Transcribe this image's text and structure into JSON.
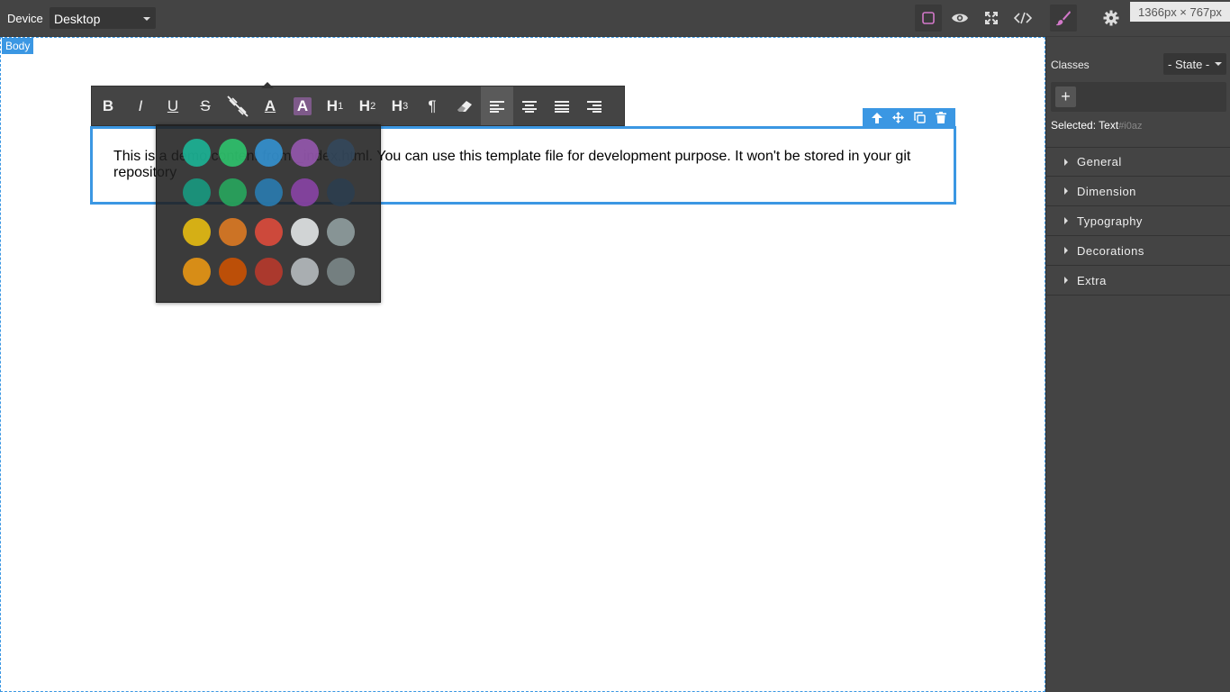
{
  "topbar": {
    "device_label": "Device",
    "device_value": "Desktop",
    "size_badge": "1366px × 767px",
    "buttons": [
      {
        "name": "sw-visibility-icon",
        "active": true
      },
      {
        "name": "preview-eye-icon",
        "active": false
      },
      {
        "name": "fullscreen-icon",
        "active": false
      },
      {
        "name": "code-icon",
        "active": false
      },
      {
        "name": "style-manager-brush-icon",
        "active": true
      },
      {
        "name": "settings-gear-icon",
        "active": false
      }
    ]
  },
  "canvas": {
    "body_badge": "Body",
    "text_content": "This is a demo content from _index.html. You can use this template file for development purpose. It won't be stored in your git repository"
  },
  "rte": {
    "buttons": [
      {
        "label": "B",
        "name": "bold-button"
      },
      {
        "label": "I",
        "name": "italic-button"
      },
      {
        "label": "U",
        "name": "underline-button"
      },
      {
        "label": "S",
        "name": "strikethrough-button"
      },
      {
        "label": "",
        "name": "unlink-button"
      },
      {
        "label": "A",
        "name": "font-color-button"
      },
      {
        "label": "A",
        "name": "highlight-color-button"
      },
      {
        "label": "H",
        "sub": "1",
        "name": "heading1-button"
      },
      {
        "label": "H",
        "sub": "2",
        "name": "heading2-button"
      },
      {
        "label": "H",
        "sub": "3",
        "name": "heading3-button"
      },
      {
        "label": "¶",
        "name": "paragraph-button"
      },
      {
        "label": "",
        "name": "clear-format-button"
      },
      {
        "label": "",
        "name": "align-left-button"
      },
      {
        "label": "",
        "name": "align-center-button"
      },
      {
        "label": "",
        "name": "align-justify-button"
      },
      {
        "label": "",
        "name": "align-right-button"
      }
    ],
    "palette": [
      [
        "#1abc9c",
        "#2ecc71",
        "#3498db",
        "#9b59b6",
        "#34495e"
      ],
      [
        "#16a085",
        "#27ae60",
        "#2980b9",
        "#8e44ad",
        "#2c3e50"
      ],
      [
        "#f1c40f",
        "#e67e22",
        "#e74c3c",
        "#ecf0f1",
        "#95a5a6"
      ],
      [
        "#f39c12",
        "#d35400",
        "#c0392b",
        "#bdc3c7",
        "#7f8c8d"
      ]
    ]
  },
  "panel": {
    "classes_label": "Classes",
    "state_value": "- State -",
    "add_label": "+",
    "selected_label": "Selected:",
    "selected_name": "Text",
    "selected_id": "#i0az",
    "sectors": [
      "General",
      "Dimension",
      "Typography",
      "Decorations",
      "Extra"
    ]
  },
  "colors": {
    "accent": "#3b97e3",
    "panel_bg": "#444444"
  }
}
